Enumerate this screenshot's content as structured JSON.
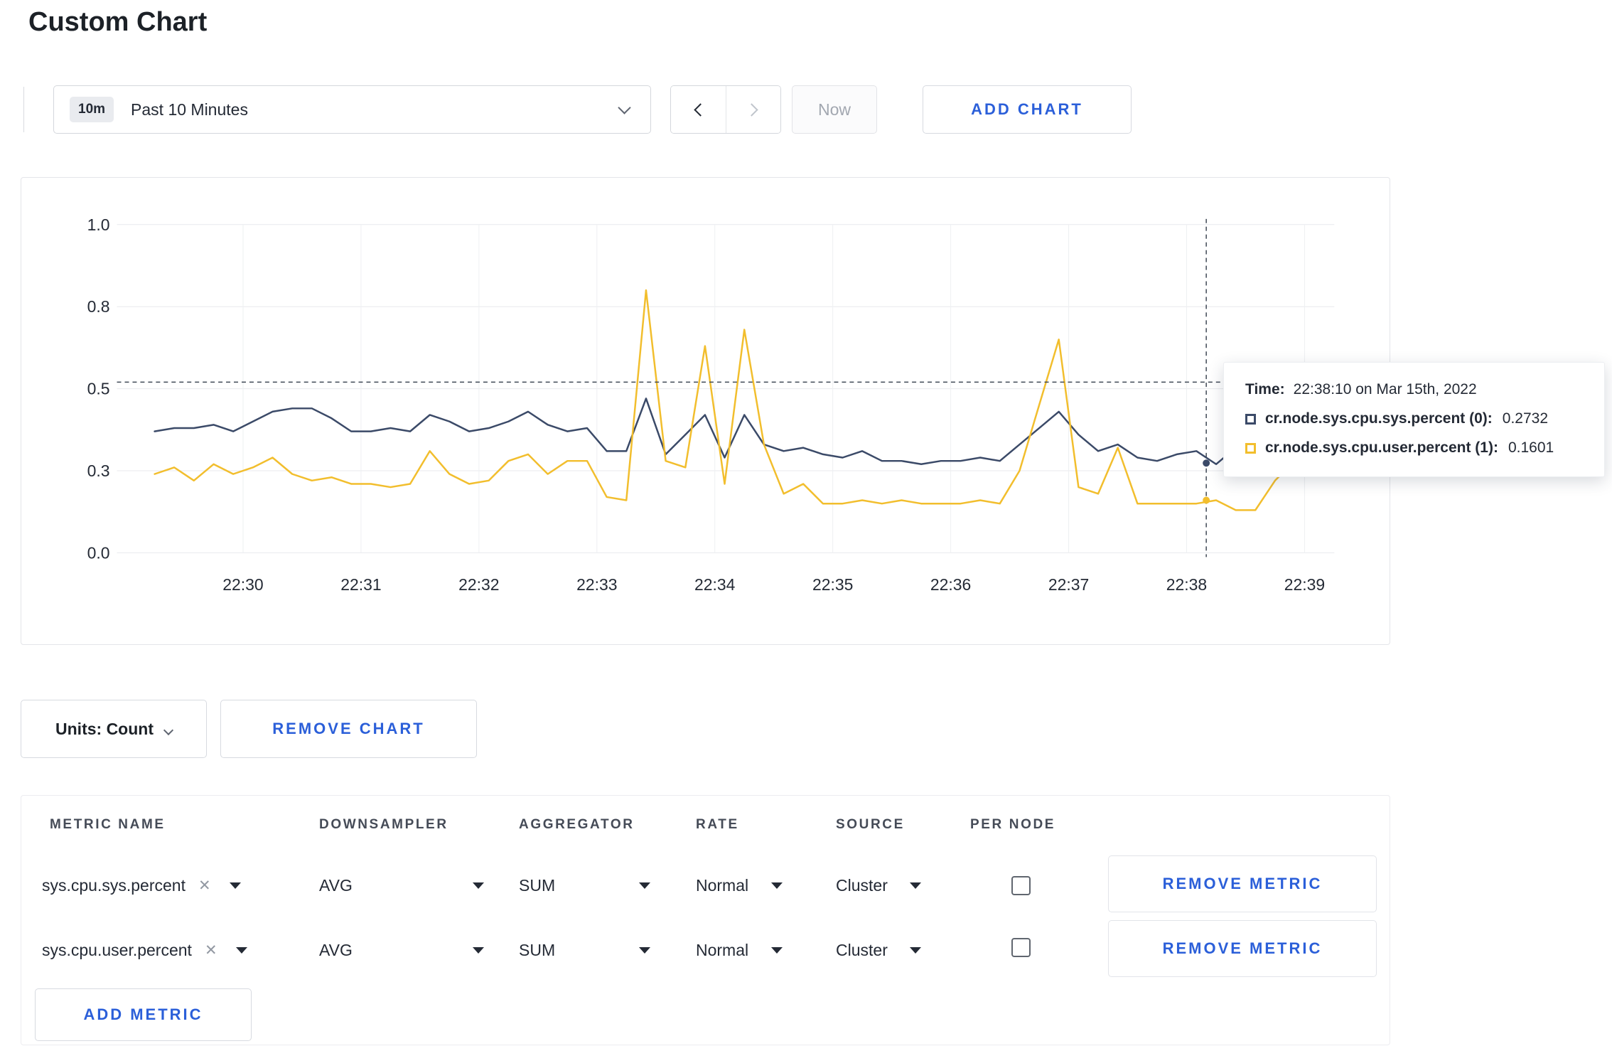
{
  "page": {
    "title": "Custom Chart"
  },
  "toolbar": {
    "time_range": {
      "badge": "10m",
      "label": "Past 10 Minutes"
    },
    "now_label": "Now",
    "add_chart_label": "ADD CHART"
  },
  "tooltip": {
    "time_label": "Time:",
    "time_value": "22:38:10 on Mar 15th, 2022",
    "rows": [
      {
        "label": "cr.node.sys.cpu.sys.percent (0):",
        "value": "0.2732",
        "color": "#3b4a68"
      },
      {
        "label": "cr.node.sys.cpu.user.percent (1):",
        "value": "0.1601",
        "color": "#f2be2d"
      }
    ]
  },
  "units": {
    "label": "Units: Count",
    "remove_chart_label": "REMOVE CHART"
  },
  "table": {
    "headers": [
      "METRIC NAME",
      "DOWNSAMPLER",
      "AGGREGATOR",
      "RATE",
      "SOURCE",
      "PER NODE"
    ],
    "rows": [
      {
        "metric": "sys.cpu.sys.percent",
        "downsampler": "AVG",
        "aggregator": "SUM",
        "rate": "Normal",
        "source": "Cluster",
        "per_node": false,
        "remove_label": "REMOVE METRIC"
      },
      {
        "metric": "sys.cpu.user.percent",
        "downsampler": "AVG",
        "aggregator": "SUM",
        "rate": "Normal",
        "source": "Cluster",
        "per_node": false,
        "remove_label": "REMOVE METRIC"
      }
    ],
    "add_metric_label": "ADD METRIC",
    "remove_icon": "✕"
  },
  "colors": {
    "accent_blue": "#2b5fd9",
    "series_sys": "#3b4a68",
    "series_user": "#f2be2d"
  },
  "chart_data": {
    "type": "line",
    "title": "",
    "x_ticks": [
      "22:30",
      "22:31",
      "22:32",
      "22:33",
      "22:34",
      "22:35",
      "22:36",
      "22:37",
      "22:38",
      "22:39"
    ],
    "y_ticks": [
      "0.0",
      "0.3",
      "0.5",
      "0.8",
      "1.0"
    ],
    "y_tick_values": [
      0,
      0.25,
      0.5,
      0.75,
      1.0
    ],
    "ylim": [
      0,
      1
    ],
    "grid": true,
    "legend_position": "tooltip",
    "x_start_offset_sec": -45,
    "x_step_sec": 10,
    "series": [
      {
        "name": "cr.node.sys.cpu.sys.percent",
        "color": "#3b4a68",
        "values": [
          0.37,
          0.38,
          0.38,
          0.39,
          0.37,
          0.4,
          0.43,
          0.44,
          0.44,
          0.41,
          0.37,
          0.37,
          0.38,
          0.37,
          0.42,
          0.4,
          0.37,
          0.38,
          0.4,
          0.43,
          0.39,
          0.37,
          0.38,
          0.31,
          0.31,
          0.47,
          0.3,
          0.36,
          0.42,
          0.29,
          0.42,
          0.33,
          0.31,
          0.32,
          0.3,
          0.29,
          0.31,
          0.28,
          0.28,
          0.27,
          0.28,
          0.28,
          0.29,
          0.28,
          0.33,
          0.38,
          0.43,
          0.36,
          0.31,
          0.33,
          0.29,
          0.28,
          0.3,
          0.31,
          0.27,
          0.32,
          0.31,
          0.3,
          0.3,
          0.3
        ]
      },
      {
        "name": "cr.node.sys.cpu.user.percent",
        "color": "#f2be2d",
        "values": [
          0.24,
          0.26,
          0.22,
          0.27,
          0.24,
          0.26,
          0.29,
          0.24,
          0.22,
          0.23,
          0.21,
          0.21,
          0.2,
          0.21,
          0.31,
          0.24,
          0.21,
          0.22,
          0.28,
          0.3,
          0.24,
          0.28,
          0.28,
          0.17,
          0.16,
          0.8,
          0.28,
          0.26,
          0.63,
          0.21,
          0.68,
          0.33,
          0.18,
          0.21,
          0.15,
          0.15,
          0.16,
          0.15,
          0.16,
          0.15,
          0.15,
          0.15,
          0.16,
          0.15,
          0.25,
          0.45,
          0.65,
          0.2,
          0.18,
          0.32,
          0.15,
          0.15,
          0.15,
          0.15,
          0.16,
          0.13,
          0.13,
          0.22,
          0.28,
          0.24
        ]
      }
    ],
    "crosshair": {
      "time": "22:38:10",
      "x_offset_sec": 490,
      "y_value": 0.52,
      "points": [
        0.2732,
        0.1601
      ]
    }
  }
}
